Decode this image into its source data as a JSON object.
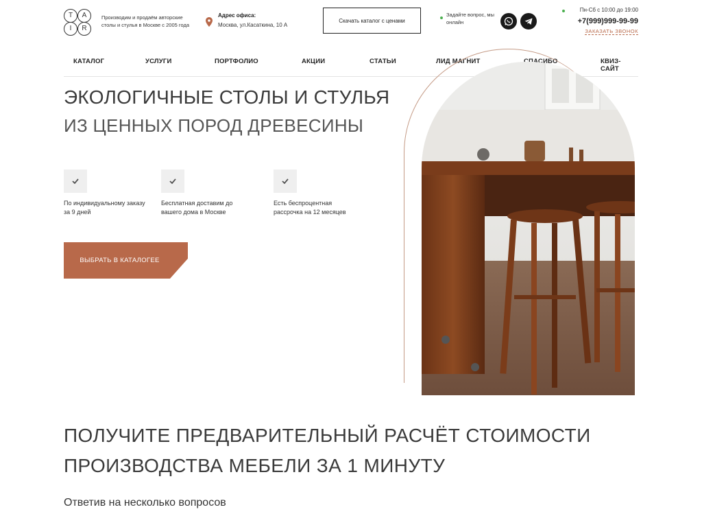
{
  "header": {
    "logo_letters": [
      "T",
      "A",
      "I",
      "R"
    ],
    "tagline": "Производим и продаём авторские столы и стулья в Москве с 2005 года",
    "address_label": "Адрес офиса:",
    "address_value": "Москва, ул.Касаткина, 10 А",
    "catalog_button": "Скачать каталог с ценами",
    "online_text": "Задайте вопрос, мы онлайн",
    "hours": "Пн-Сб с 10:00 до 19:00",
    "phone": "+7(999)999-99-99",
    "callback": "ЗАКАЗАТЬ ЗВОНОК",
    "socials": [
      "whatsapp-icon",
      "telegram-icon"
    ]
  },
  "nav": {
    "items": [
      "КАТАЛОГ",
      "УСЛУГИ",
      "ПОРТФОЛИО",
      "АКЦИИ",
      "СТАТЬИ",
      "ЛИД МАГНИТ",
      "СПАСИБО",
      "КВИЗ-САЙТ"
    ]
  },
  "hero": {
    "title_line1": "ЭКОЛОГИЧНЫЕ СТОЛЫ И СТУЛЬЯ",
    "title_line2": "ИЗ ЦЕННЫХ ПОРОД ДРЕВЕСИНЫ",
    "features": [
      {
        "icon": "check-icon",
        "text": "По индивидуальному заказу за 9 дней"
      },
      {
        "icon": "check-icon",
        "text": "Бесплатная доставим до вашего дома в Москве"
      },
      {
        "icon": "check-icon",
        "text": "Есть беспроцентная рассрочка на 12 месяцев"
      }
    ],
    "cta": "ВЫБРАТЬ В КАТАЛОГЕЕ"
  },
  "calc": {
    "title_line1": "ПОЛУЧИТЕ ПРЕДВАРИТЕЛЬНЫЙ РАСЧЁТ СТОИМОСТИ",
    "title_line2": "ПРОИЗВОДСТВА МЕБЕЛИ ЗА 1 МИНУТУ",
    "subtitle": "Ответив на несколько вопросов"
  },
  "colors": {
    "accent": "#b8694a",
    "online": "#4caf50",
    "dark": "#1a1a1a"
  }
}
